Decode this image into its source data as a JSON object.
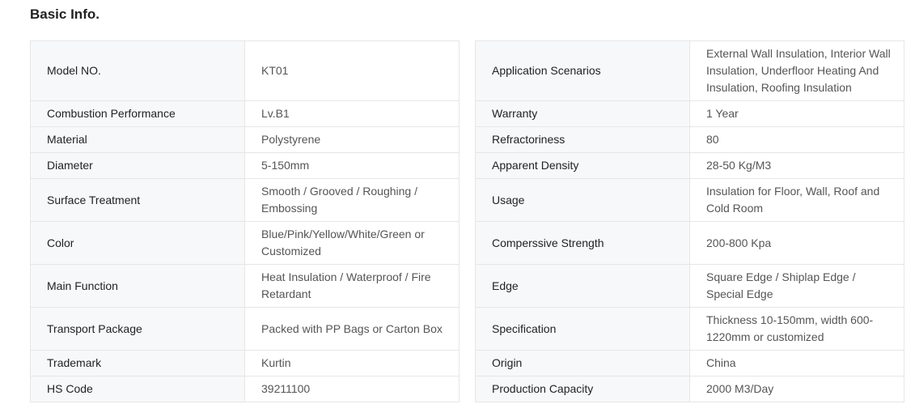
{
  "section": {
    "title": "Basic Info."
  },
  "left_table": [
    {
      "key": "Model NO.",
      "value": "KT01"
    },
    {
      "key": "Combustion Performance",
      "value": "Lv.B1"
    },
    {
      "key": "Material",
      "value": "Polystyrene"
    },
    {
      "key": "Diameter",
      "value": "5-150mm"
    },
    {
      "key": "Surface Treatment",
      "value": "Smooth / Grooved / Roughing / Embossing"
    },
    {
      "key": "Color",
      "value": "Blue/Pink/Yellow/White/Green or Customized"
    },
    {
      "key": "Main Function",
      "value": "Heat Insulation / Waterproof / Fire Retardant"
    },
    {
      "key": "Transport Package",
      "value": "Packed with PP Bags or Carton Box"
    },
    {
      "key": "Trademark",
      "value": "Kurtin"
    },
    {
      "key": "HS Code",
      "value": "39211100"
    }
  ],
  "right_table": [
    {
      "key": "Application Scenarios",
      "value": "External Wall Insulation, Interior Wall Insulation, Underfloor Heating And Insulation, Roofing Insulation"
    },
    {
      "key": "Warranty",
      "value": "1 Year"
    },
    {
      "key": "Refractoriness",
      "value": "80"
    },
    {
      "key": "Apparent Density",
      "value": "28-50 Kg/M3"
    },
    {
      "key": "Usage",
      "value": "Insulation for Floor, Wall, Roof and Cold Room"
    },
    {
      "key": "Comperssive Strength",
      "value": "200-800 Kpa"
    },
    {
      "key": "Edge",
      "value": "Square Edge / Shiplap Edge / Special Edge"
    },
    {
      "key": "Specification",
      "value": "Thickness 10-150mm, width 600-1220mm or customized"
    },
    {
      "key": "Origin",
      "value": "China"
    },
    {
      "key": "Production Capacity",
      "value": "2000 M3/Day"
    }
  ]
}
